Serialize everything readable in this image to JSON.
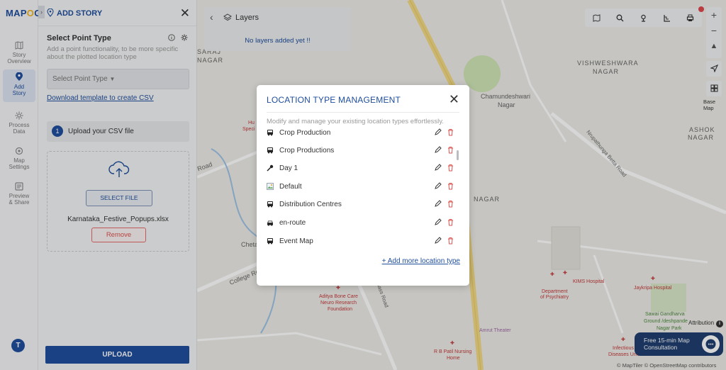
{
  "app": {
    "logo_part1": "MAP",
    "logo_part2": "O",
    "logo_part3": "G"
  },
  "rail": {
    "items": [
      {
        "label1": "Story",
        "label2": "Overview"
      },
      {
        "label1": "Add",
        "label2": "Story"
      },
      {
        "label1": "Process",
        "label2": "Data"
      },
      {
        "label1": "Map",
        "label2": "Settings"
      },
      {
        "label1": "Preview",
        "label2": "& Share"
      }
    ],
    "avatar": "T"
  },
  "panel": {
    "title": "ADD STORY",
    "section_title": "Select Point Type",
    "section_desc": "Add a point functionality, to be more specific about the plotted location type",
    "select_placeholder": "Select Point Type",
    "template_link": "Download template to create CSV",
    "step_number": "1",
    "step_label": "Upload your CSV file",
    "select_file_label": "SELECT FILE",
    "file_name": "Karnataka_Festive_Popups.xlsx",
    "remove_label": "Remove",
    "upload_label": "UPLOAD"
  },
  "map": {
    "layers_title": "Layers",
    "layers_empty": "No layers added yet !!",
    "basemap_label": "Base Map",
    "attribution": "Attribution",
    "consult_line1": "Free 15-min Map",
    "consult_line2": "Consultation",
    "copyright": "© MapTiler © OpenStreetMap contributors",
    "labels": {
      "vishweshwara": "VISHWESHWARA",
      "nagar1": "NAGAR",
      "chamundeshwari": "Chamundeshwari",
      "nagar2": "Nagar",
      "ashok": "ASHOK",
      "nagar3": "NAGAR",
      "saraj": "SARAJ",
      "nagar4": "NAGAR",
      "nagar5": "NAGAR",
      "road": "Road",
      "college_road": "College Road",
      "chet": "Chetan",
      "hul": "Hu",
      "spec": "Speci",
      "nrupathunga": "Nrupathunga Betta Road",
      "bypass": "Bypass Road"
    },
    "pois": {
      "kims": "KIMS Hospital",
      "jaykripa": "Jaykripa Hospital",
      "psych1": "Department",
      "psych2": "of Psychiatry",
      "aditya1": "Aditya Bone Care",
      "aditya2": "Neuro Research",
      "aditya3": "Foundation",
      "sawai1": "Sawai Gandharva",
      "sawai2": "Ground /deshpande",
      "sawai3": "Nagar Park",
      "amrut": "Amrut Theater",
      "rb1": "R B Patil Nursing",
      "rb2": "Home",
      "infect1": "Infectious",
      "infect2": "Diseases Unit"
    }
  },
  "modal": {
    "title": "LOCATION TYPE MANAGEMENT",
    "subtitle": "Modify and manage your existing location types effortlessly.",
    "items": [
      {
        "label": "Crop Production",
        "icon": "bus-icon"
      },
      {
        "label": "Crop Productions",
        "icon": "bus-icon"
      },
      {
        "label": "Day 1",
        "icon": "microphone-icon"
      },
      {
        "label": "Default",
        "icon": "image-icon"
      },
      {
        "label": "Distribution Centres",
        "icon": "bus-icon"
      },
      {
        "label": "en-route",
        "icon": "car-icon"
      },
      {
        "label": "Event Map",
        "icon": "bus-icon"
      }
    ],
    "add_more": "+ Add more location type",
    "accent": "#1f4e9c",
    "danger": "#d9534f"
  }
}
